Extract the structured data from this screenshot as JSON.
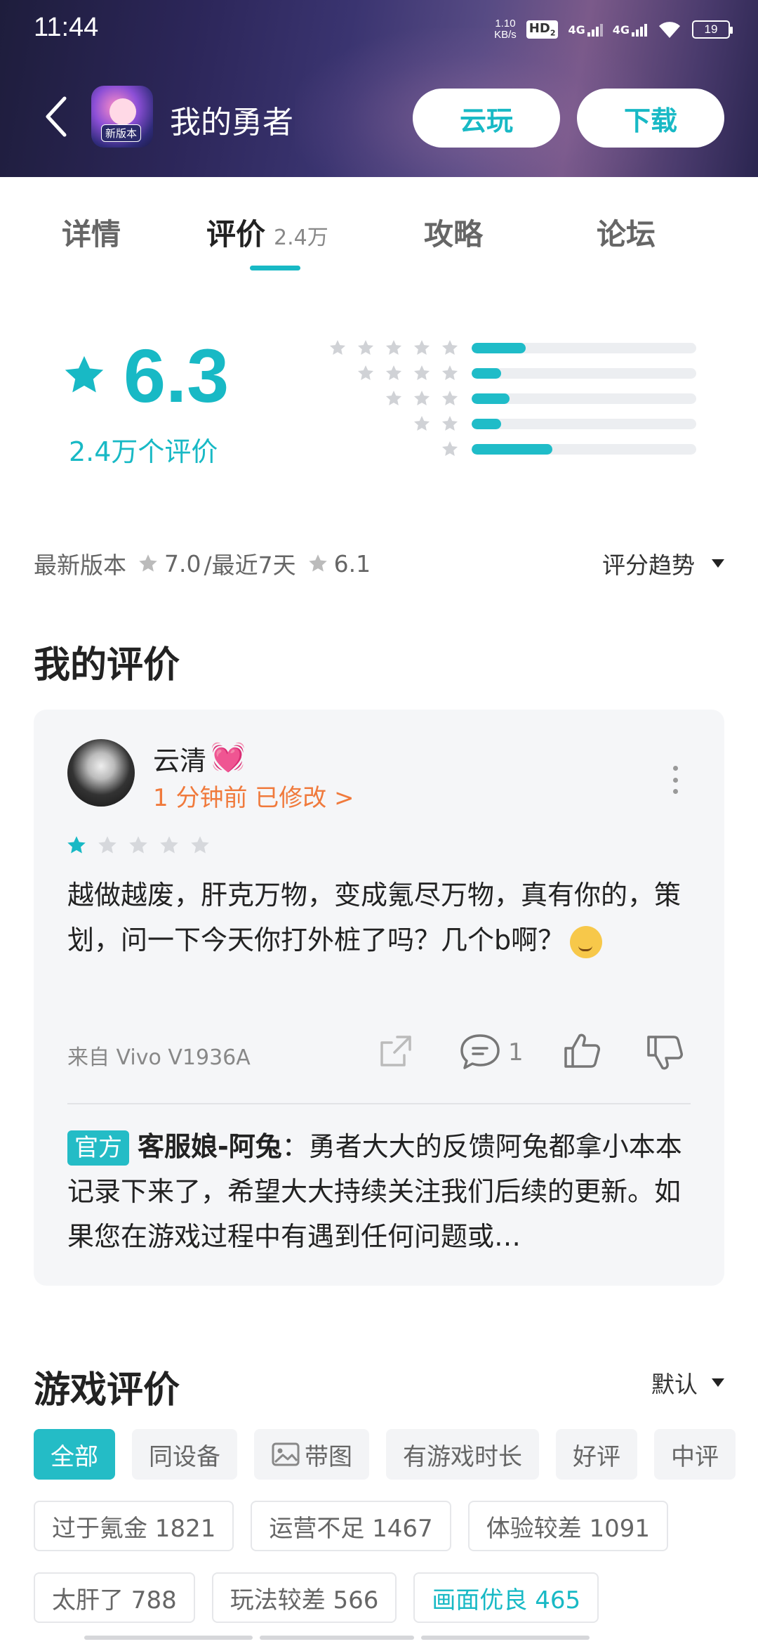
{
  "status_bar": {
    "time": "11:44",
    "speed_value": "1.10",
    "speed_unit": "KB/s",
    "hd_label": "HD",
    "hd_sub": "2",
    "network_label_1": "4G",
    "network_label_2": "4G",
    "battery": "19"
  },
  "header": {
    "back_icon": "chevron-left-icon",
    "app_icon_tag": "新版本",
    "title": "我的勇者",
    "cloud_play_label": "云玩",
    "download_label": "下载"
  },
  "tabs": [
    {
      "label": "详情"
    },
    {
      "label": "评价",
      "count": "2.4万",
      "active": true
    },
    {
      "label": "攻略"
    },
    {
      "label": "论坛"
    }
  ],
  "rating": {
    "score": "6.3",
    "count_text": "2.4万个评价",
    "distribution": [
      {
        "stars": 5,
        "fraction": 0.24
      },
      {
        "stars": 4,
        "fraction": 0.13
      },
      {
        "stars": 3,
        "fraction": 0.17
      },
      {
        "stars": 2,
        "fraction": 0.13
      },
      {
        "stars": 1,
        "fraction": 0.36
      }
    ]
  },
  "version_info": {
    "latest_label": "最新版本",
    "latest_score": "7.0",
    "recent_label": "/最近7天",
    "recent_score": "6.1",
    "trend_label": "评分趋势"
  },
  "my_review": {
    "section_title": "我的评价",
    "user_name": "云清",
    "heart_emoji": "💓",
    "meta": "1 分钟前  已修改 >",
    "stars_filled": 1,
    "stars_total": 5,
    "text": "越做越废，肝克万物，变成氪尽万物，真有你的，策划，问一下今天你打外桩了吗？几个b啊？",
    "device": "来自 Vivo V1936A",
    "comment_count": "1",
    "reply_tag": "官方",
    "reply_author": "客服娘-阿兔",
    "reply_text": "：勇者大大的反馈阿兔都拿小本本记录下来了，希望大大持续关注我们后续的更新。如果您在游戏过程中有遇到任何问题或…"
  },
  "game_reviews": {
    "section_title": "游戏评价",
    "sort_label": "默认",
    "filters": [
      "全部",
      "同设备",
      "带图",
      "有游戏时长",
      "好评",
      "中评"
    ],
    "tags_row1": [
      "过于氪金 1821",
      "运营不足 1467",
      "体验较差 1091"
    ],
    "tags_row2": [
      "太肝了 788",
      "玩法较差 566",
      "画面优良 465"
    ]
  },
  "colors": {
    "accent": "#18b9c5",
    "orange": "#f07a3c"
  }
}
